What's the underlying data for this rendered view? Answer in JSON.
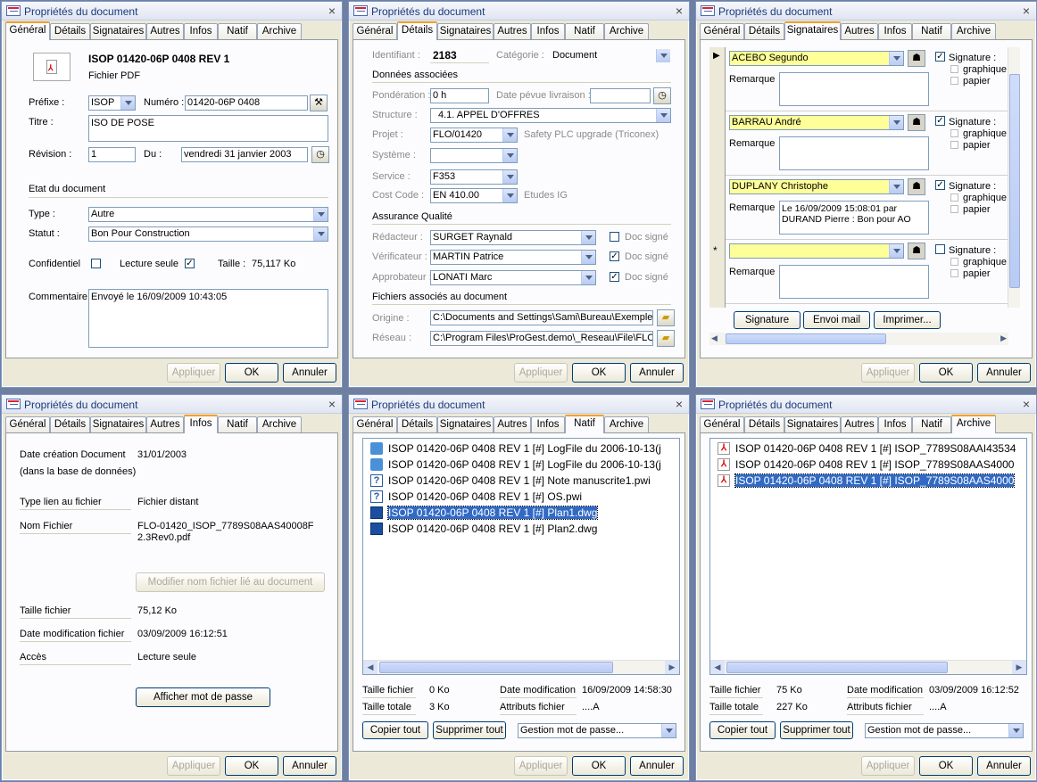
{
  "window_title": "Propriétés du document",
  "tabs": [
    "Général",
    "Détails",
    "Signataires",
    "Autres",
    "Infos",
    "Natif",
    "Archive"
  ],
  "buttons": {
    "apply": "Appliquer",
    "ok": "OK",
    "cancel": "Annuler"
  },
  "general": {
    "doc_title": "ISOP 01420-06P 0408 REV 1",
    "file_type": "Fichier PDF",
    "prefix_label": "Préfixe :",
    "prefix_value": "ISOP",
    "number_label": "Numéro :",
    "number_value": "01420-06P 0408",
    "title_label": "Titre :",
    "title_value": "ISO DE POSE",
    "revision_label": "Révision :",
    "revision_value": "1",
    "du_label": "Du :",
    "du_value": "vendredi 31 janvier 2003",
    "state_heading": "Etat du document",
    "type_label": "Type :",
    "type_value": "Autre",
    "status_label": "Statut :",
    "status_value": "Bon Pour Construction",
    "confidential_label": "Confidentiel",
    "readonly_label": "Lecture seule",
    "size_label": "Taille :",
    "size_value": "75,117 Ko",
    "comment_label": "Commentaire",
    "comment_value": "Envoyé le 16/09/2009 10:43:05"
  },
  "details": {
    "id_label": "Identifiant :",
    "id_value": "2183",
    "category_label": "Catégorie :",
    "category_value": "Document",
    "assoc_heading": "Données associées",
    "weight_label": "Pondération :",
    "weight_value": "0 h",
    "delivery_label": "Date pévue livraison :",
    "delivery_value": "",
    "structure_label": "Structure :",
    "structure_value": "4.1. APPEL D'OFFRES",
    "project_label": "Projet :",
    "project_value": "FLO/01420",
    "project_desc": "Safety PLC upgrade (Triconex)",
    "system_label": "Système :",
    "system_value": "",
    "service_label": "Service :",
    "service_value": "F353",
    "costcode_label": "Cost Code :",
    "costcode_value": "EN 410.00",
    "costcode_desc": "Etudes IG",
    "qa_heading": "Assurance Qualité",
    "writer_label": "Rédacteur :",
    "writer_value": "SURGET Raynald",
    "verifier_label": "Vérificateur :",
    "verifier_value": "MARTIN Patrice",
    "approver_label": "Approbateur :",
    "approver_value": "LONATI Marc",
    "signed_label": "Doc signé",
    "files_heading": "Fichiers associés au document",
    "origin_label": "Origine :",
    "origin_value": "C:\\Documents and Settings\\Sami\\Bureau\\Exemple",
    "network_label": "Réseau :",
    "network_value": "C:\\Program Files\\ProGest.demo\\_Reseau\\File\\FLO"
  },
  "signataires": {
    "remark_label": "Remarque",
    "signature_label": "Signature :",
    "graphic_label": "graphique",
    "paper_label": "papier",
    "rows": [
      {
        "name": "ACEBO Segundo",
        "remark": "",
        "signed": "✓"
      },
      {
        "name": "BARRAU André",
        "remark": "",
        "signed": "✓"
      },
      {
        "name": "DUPLANY Christophe",
        "remark": "Le 16/09/2009 15:08:01 par DURAND Pierre : Bon pour AO",
        "signed": "✓"
      },
      {
        "name": "",
        "remark": "",
        "signed": ""
      }
    ],
    "btn_signature": "Signature",
    "btn_mail": "Envoi mail",
    "btn_print": "Imprimer..."
  },
  "infos": {
    "created_label": "Date création Document",
    "created_sub": "(dans la base de données)",
    "created_value": "31/01/2003",
    "link_label": "Type lien au fichier",
    "link_value": "Fichier distant",
    "filename_label": "Nom Fichier",
    "filename_value": "FLO-01420_ISOP_7789S08AAS40008F2.3Rev0.pdf",
    "rename_btn": "Modifier nom fichier lié au document",
    "filesize_label": "Taille fichier",
    "filesize_value": "75,12 Ko",
    "modified_label": "Date modification fichier",
    "modified_value": "03/09/2009 16:12:51",
    "access_label": "Accès",
    "access_value": "Lecture seule",
    "password_btn": "Afficher mot de passe"
  },
  "natif": {
    "files": [
      {
        "name": "ISOP 01420-06P 0408 REV 1 [#] LogFile du 2006-10-13(j",
        "icon": "log-icon"
      },
      {
        "name": "ISOP 01420-06P 0408 REV 1 [#] LogFile du 2006-10-13(j",
        "icon": "log-icon"
      },
      {
        "name": "ISOP 01420-06P 0408 REV 1 [#] Note manuscrite1.pwi",
        "icon": "unknown-icon"
      },
      {
        "name": "ISOP 01420-06P 0408 REV 1 [#] OS.pwi",
        "icon": "unknown-icon"
      },
      {
        "name": "ISOP 01420-06P 0408 REV 1 [#] Plan1.dwg",
        "icon": "dwg-icon"
      },
      {
        "name": "ISOP 01420-06P 0408 REV 1 [#] Plan2.dwg",
        "icon": "dwg-icon"
      }
    ],
    "file_size_label": "Taille fichier",
    "file_size_value": "0 Ko",
    "total_size_label": "Taille totale",
    "total_size_value": "3 Ko",
    "modified_label": "Date modification",
    "modified_value": "16/09/2009 14:58:30",
    "attr_label": "Attributs fichier",
    "attr_value": "....A"
  },
  "archive": {
    "files": [
      {
        "name": "ISOP 01420-06P 0408 REV 1 [#] ISOP_7789S08AAI43534"
      },
      {
        "name": "ISOP 01420-06P 0408 REV 1 [#] ISOP_7789S08AAS4000"
      },
      {
        "name": "ISOP 01420-06P 0408 REV 1 [#] ISOP_7789S08AAS4000"
      }
    ],
    "file_size_label": "Taille fichier",
    "file_size_value": "75 Ko",
    "total_size_label": "Taille totale",
    "total_size_value": "227 Ko",
    "modified_label": "Date modification",
    "modified_value": "03/09/2009 16:12:52",
    "attr_label": "Attributs fichier",
    "attr_value": "....A"
  },
  "shared": {
    "copy_all": "Copier tout",
    "delete_all": "Supprimer tout",
    "password_mgmt": "Gestion mot de passe..."
  },
  "colors": {
    "accent": "#316ac5",
    "tab_highlight": "#f0a030",
    "yellow_field": "#ffff99"
  }
}
